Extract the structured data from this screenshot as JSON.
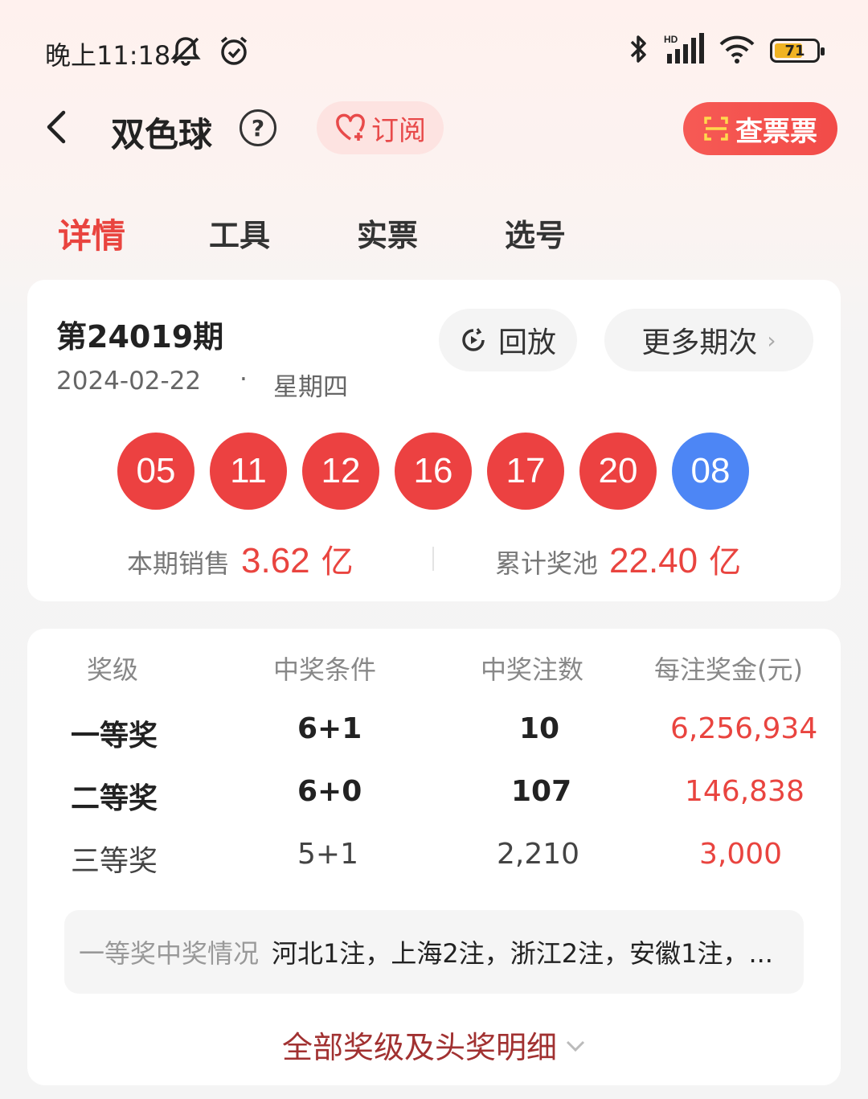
{
  "status_bar": {
    "time": "晚上11:18",
    "battery": "71",
    "icons_left": [
      "mute-icon",
      "alarm-icon"
    ],
    "icons_right": [
      "bluetooth-icon",
      "signal-icon",
      "wifi-icon",
      "battery-icon"
    ],
    "battery_color": "#f0b323"
  },
  "header": {
    "title": "双色球",
    "help": "?",
    "subscribe": "订阅",
    "check_ticket": "查票票"
  },
  "tabs": [
    {
      "label": "详情",
      "active": true
    },
    {
      "label": "工具",
      "active": false
    },
    {
      "label": "实票",
      "active": false
    },
    {
      "label": "选号",
      "active": false
    }
  ],
  "draw": {
    "issue": "第24019期",
    "date": "2024-02-22",
    "dot": "·",
    "weekday": "星期四",
    "replay": "回放",
    "more_issues": "更多期次",
    "red_balls": [
      "05",
      "11",
      "12",
      "16",
      "17",
      "20"
    ],
    "blue_ball": "08",
    "sales_label": "本期销售",
    "sales_value": "3.62",
    "sales_unit": "亿",
    "pool_label": "累计奖池",
    "pool_value": "22.40",
    "pool_unit": "亿"
  },
  "prize_table": {
    "headers": [
      "奖级",
      "中奖条件",
      "中奖注数",
      "每注奖金(元)"
    ],
    "rows": [
      {
        "level": "一等奖",
        "condition": "6+1",
        "count": "10",
        "amount": "6,256,934"
      },
      {
        "level": "二等奖",
        "condition": "6+0",
        "count": "107",
        "amount": "146,838"
      },
      {
        "level": "三等奖",
        "condition": "5+1",
        "count": "2,210",
        "amount": "3,000"
      }
    ],
    "first_prize_label": "一等奖中奖情况",
    "first_prize_detail": "河北1注，上海2注，浙江2注，安徽1注，...",
    "all_prizes": "全部奖级及头奖明细"
  },
  "colors": {
    "accent_red": "#e9443f",
    "ball_red": "#ec4141",
    "ball_blue": "#4d86f5",
    "link_dark_red": "#a13131"
  }
}
